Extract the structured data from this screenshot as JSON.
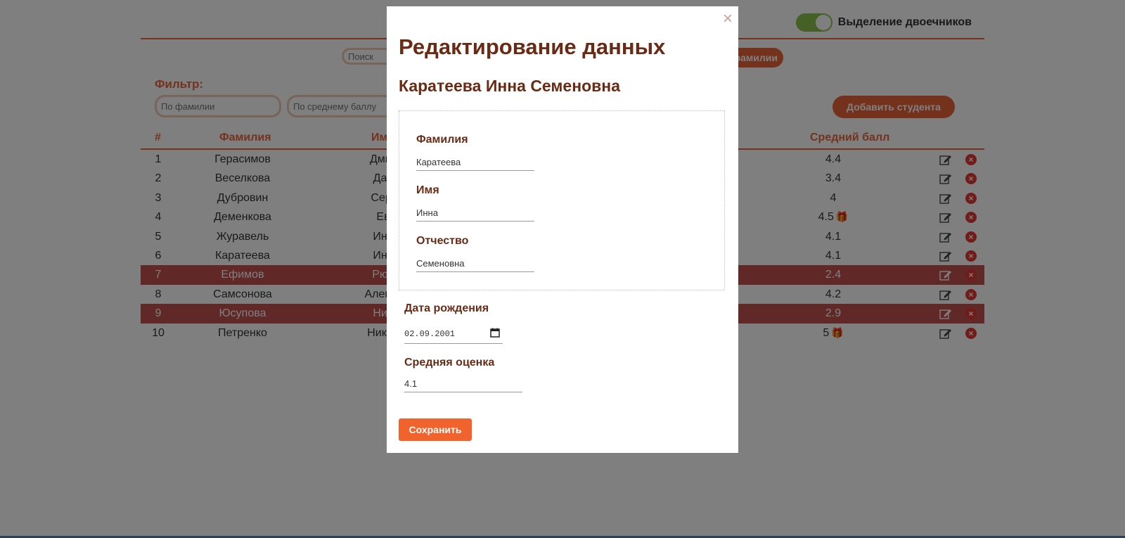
{
  "toggle": {
    "label": "Выделение двоечников",
    "on": true
  },
  "search": {
    "placeholder": "Поиск"
  },
  "sort_button": {
    "label": "фамилии"
  },
  "filter": {
    "label": "Фильтр:",
    "surname_placeholder": "По фамилии",
    "avg_placeholder": "По среднему баллу"
  },
  "add_button": {
    "label": "Добавить студента"
  },
  "table": {
    "headers": {
      "num": "#",
      "surname": "Фамилия",
      "name": "Им",
      "avg": "Средний балл"
    },
    "rows": [
      {
        "num": "1",
        "surname": "Герасимов",
        "name": "Дмит",
        "avg": "4.4",
        "gift": false,
        "bad": false
      },
      {
        "num": "2",
        "surname": "Веселкова",
        "name": "Дар",
        "avg": "3.4",
        "gift": false,
        "bad": false
      },
      {
        "num": "3",
        "surname": "Дубровин",
        "name": "Серг",
        "avg": "4",
        "gift": false,
        "bad": false
      },
      {
        "num": "4",
        "surname": "Деменкова",
        "name": "Ев",
        "avg": "4.5",
        "gift": true,
        "bad": false
      },
      {
        "num": "5",
        "surname": "Журавель",
        "name": "Инн",
        "avg": "4.1",
        "gift": false,
        "bad": false
      },
      {
        "num": "6",
        "surname": "Каратеева",
        "name": "Инн",
        "avg": "4.1",
        "gift": false,
        "bad": false
      },
      {
        "num": "7",
        "surname": "Ефимов",
        "name": "Рюр",
        "avg": "2.4",
        "gift": false,
        "bad": true
      },
      {
        "num": "8",
        "surname": "Самсонова",
        "name": "Алекса",
        "avg": "4.2",
        "gift": false,
        "bad": false
      },
      {
        "num": "9",
        "surname": "Юсупова",
        "name": "Нин",
        "avg": "2.9",
        "gift": false,
        "bad": true
      },
      {
        "num": "10",
        "surname": "Петренко",
        "name": "Никол",
        "avg": "5",
        "gift": true,
        "bad": false
      }
    ]
  },
  "modal": {
    "close_symbol": "×",
    "title": "Редактирование данных",
    "student_name": "Каратеева Инна Семеновна",
    "surname_label": "Фамилия",
    "surname_value": "Каратеева",
    "name_label": "Имя",
    "name_value": "Инна",
    "patronymic_label": "Отчество",
    "patronymic_value": "Семеновна",
    "birthdate_label": "Дата рождения",
    "birthdate_value": "02.09.2001",
    "avg_label": "Средняя оценка",
    "avg_value": "4.1",
    "save_label": "Сохранить"
  },
  "colors": {
    "accent": "#e8643a",
    "bad_row": "#c0504d",
    "title": "#6b2a14",
    "toggle_on": "#8bc34a",
    "gift": "#2e7d32",
    "delete": "#e53935",
    "save": "#f0632d"
  }
}
